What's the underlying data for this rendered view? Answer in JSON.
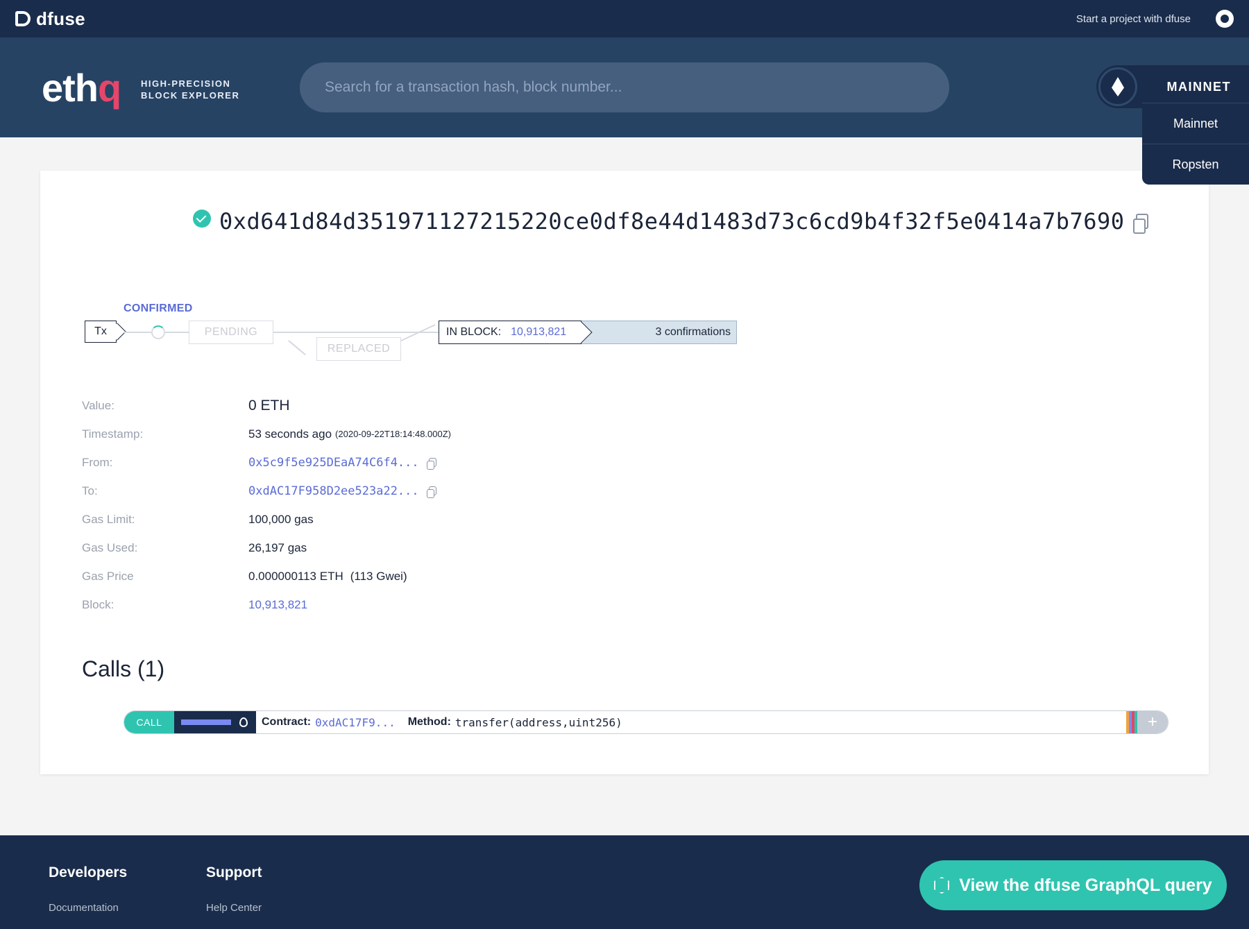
{
  "topbar": {
    "brand": "dfuse",
    "start_link": "Start a project with dfuse"
  },
  "header": {
    "logo_main": "eth",
    "logo_q": "q",
    "tagline_1": "HIGH-PRECISION",
    "tagline_2": "BLOCK EXPLORER",
    "search_placeholder": "Search for a transaction hash, block number...",
    "network": "MAINNET",
    "network_options": [
      "Mainnet",
      "Ropsten"
    ]
  },
  "tx": {
    "hash": "0xd641d84d351971127215220ce0df8e44d1483d73c6cd9b4f32f5e0414a7b7690",
    "flow": {
      "tx_label": "Tx",
      "confirmed": "CONFIRMED",
      "pending": "PENDING",
      "replaced": "REPLACED",
      "in_block_label": "IN BLOCK:",
      "in_block_value": "10,913,821",
      "confirmations": "3 confirmations"
    },
    "details": {
      "value_label": "Value:",
      "value": "0 ETH",
      "timestamp_label": "Timestamp:",
      "timestamp": "53 seconds ago",
      "timestamp_iso": "(2020-09-22T18:14:48.000Z)",
      "from_label": "From:",
      "from": "0x5c9f5e925DEaA74C6f4...",
      "to_label": "To:",
      "to": "0xdAC17F958D2ee523a22...",
      "gas_limit_label": "Gas Limit:",
      "gas_limit": "100,000 gas",
      "gas_used_label": "Gas Used:",
      "gas_used": "26,197 gas",
      "gas_price_label": "Gas Price",
      "gas_price": "0.000000113 ETH",
      "gas_price_gwei": "(113 Gwei)",
      "block_label": "Block:",
      "block": "10,913,821"
    }
  },
  "calls": {
    "title": "Calls (1)",
    "items": [
      {
        "type": "CALL",
        "contract_label": "Contract:",
        "contract": "0xdAC17F9...",
        "method_label": "Method:",
        "method": "transfer(address,uint256)"
      }
    ]
  },
  "colors": {
    "accent": "#2ec4b0",
    "link": "#5a6bd6",
    "navy": "#1a2c4b",
    "brand_q": "#e5466a"
  },
  "footer": {
    "col1_title": "Developers",
    "col1_item": "Documentation",
    "col2_title": "Support",
    "col2_item": "Help Center",
    "graphql_button": "View the dfuse GraphQL query"
  }
}
